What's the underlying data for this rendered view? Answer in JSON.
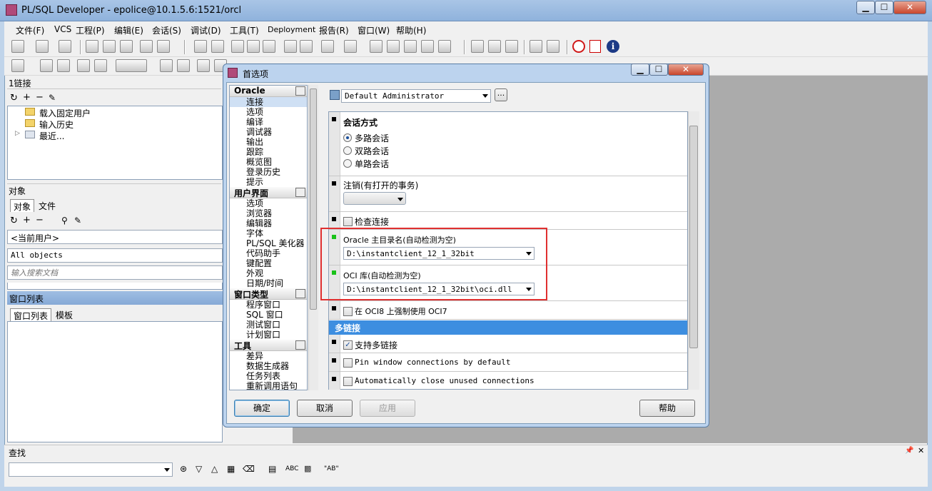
{
  "window": {
    "title": "PL/SQL Developer - epolice@10.1.5.6:1521/orcl",
    "min": "▁",
    "max": "☐",
    "close": "✕"
  },
  "menu": [
    "文件(F)",
    "VCS",
    "工程(P)",
    "编辑(E)",
    "会话(S)",
    "调试(D)",
    "工具(T)",
    "Deployment",
    "报告(R)",
    "窗口(W)",
    "帮助(H)"
  ],
  "connections": {
    "title": "1链接",
    "tree": [
      "载入固定用户",
      "输入历史",
      "最近..."
    ]
  },
  "objects": {
    "title": "对象",
    "tabs": [
      "对象",
      "文件"
    ],
    "user": "<当前用户>",
    "filter": "All objects",
    "search_placeholder": "输入搜索文档"
  },
  "windowlist": {
    "title": "窗口列表",
    "tabs": [
      "窗口列表",
      "模板"
    ]
  },
  "find": {
    "title": "查找",
    "abc": "ABC",
    "ab": "\"AB\""
  },
  "dialog": {
    "title": "首选项",
    "nav": [
      {
        "group": "Oracle",
        "items": [
          "连接",
          "选项",
          "编译",
          "调试器",
          "输出",
          "跟踪",
          "概览图",
          "登录历史",
          "提示"
        ]
      },
      {
        "group": "用户界面",
        "items": [
          "选项",
          "浏览器",
          "编辑器",
          "字体",
          "PL/SQL 美化器",
          "代码助手",
          "键配置",
          "外观",
          "日期/时间"
        ]
      },
      {
        "group": "窗口类型",
        "items": [
          "程序窗口",
          "SQL 窗口",
          "测试窗口",
          "计划窗口"
        ]
      },
      {
        "group": "工具",
        "items": [
          "差异",
          "数据生成器",
          "任务列表",
          "重新调用语句"
        ]
      }
    ],
    "profile": "Default Administrator",
    "profile_more": "...",
    "session": {
      "title": "会话方式",
      "options": [
        "多路会话",
        "双路会话",
        "单路会话"
      ],
      "selected": 0
    },
    "logoff": {
      "title": "注销(有打开的事务)",
      "value": ""
    },
    "check_conn": "检查连接",
    "oracle_home": {
      "title": "Oracle 主目录名(自动检测为空)",
      "value": "D:\\instantclient_12_1_32bit"
    },
    "oci_lib": {
      "title": "OCI 库(自动检测为空)",
      "value": "D:\\instantclient_12_1_32bit\\oci.dll"
    },
    "force_oci7": "在 OCI8 上强制使用 OCI7",
    "multi": {
      "title": "多链接",
      "support": "支持多链接",
      "support_checked": true
    },
    "pin": "Pin window connections by default",
    "autoclose": "Automatically close unused connections",
    "buttons": {
      "ok": "确定",
      "cancel": "取消",
      "apply": "应用",
      "help": "帮助"
    }
  },
  "colors": {
    "accent": "#3d8ee0",
    "highlight": "#e03030",
    "green": "#19c219"
  }
}
